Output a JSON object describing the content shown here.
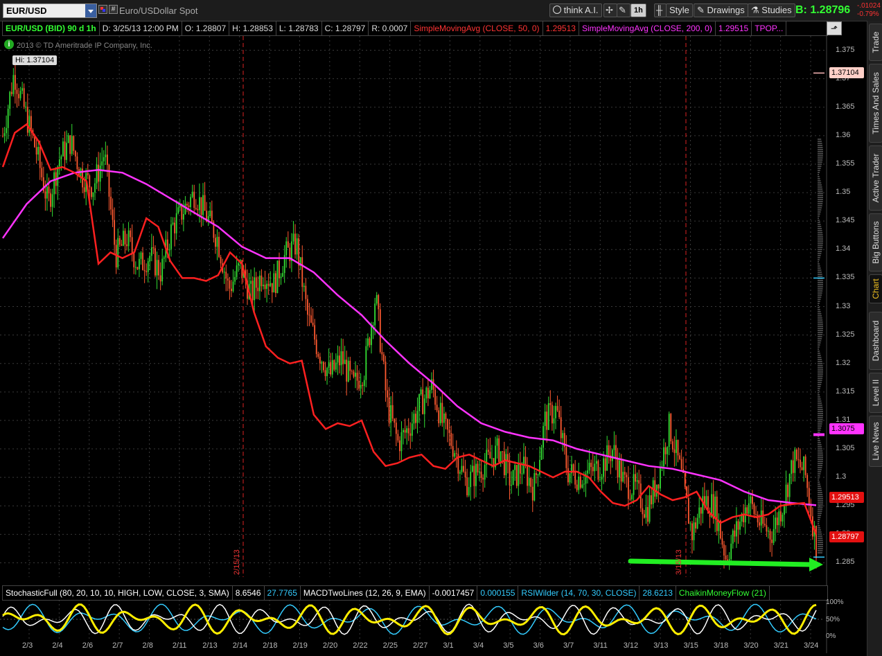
{
  "toolbar": {
    "symbol": "EUR/USD",
    "description": "Euro/USDollar Spot",
    "think_ai": "think A.I.",
    "interval": "1h",
    "style": "Style",
    "drawings": "Drawings",
    "studies": "Studies",
    "bid": "B: 1.28796",
    "change_abs": "-.01024",
    "change_pct": "-0.79%"
  },
  "info": {
    "instrument": "EUR/USD (BID) 90 d 1h",
    "date": "D: 3/25/13 12:00 PM",
    "open": "O: 1.28807",
    "high": "H: 1.28853",
    "low": "L: 1.28783",
    "close": "C: 1.28797",
    "range": "R: 0.0007",
    "sma50_label": "SimpleMovingAvg (CLOSE, 50, 0)",
    "sma50_value": "1.29513",
    "sma200_label": "SimpleMovingAvg (CLOSE, 200, 0)",
    "sma200_value": "1.29515",
    "tpop": "TPOP..."
  },
  "chart": {
    "copyright": "2013 © TD Ameritrade IP Company, Inc.",
    "hi_label": "Hi: 1.37104",
    "date_markers": [
      "2/15/13",
      "3/15/13"
    ]
  },
  "price_tags": {
    "high": "1.37104",
    "sma200": "1.3075",
    "sma50": "1.29513",
    "last": "1.28797"
  },
  "studies": {
    "stoch_label": "StochasticFull (80, 20, 10, 10, HIGH, LOW, CLOSE, 3, SMA)",
    "stoch_v1": "8.6546",
    "stoch_v2": "27.7765",
    "macd_label": "MACDTwoLines (12, 26, 9, EMA)",
    "macd_v1": "-0.0017457",
    "macd_v2": "0.000155",
    "rsi_label": "RSIWilder (14, 70, 30, CLOSE)",
    "rsi_v": "28.6213",
    "cmf_label": "ChaikinMoneyFlow (21)",
    "pct_100": "100%",
    "pct_50": "50%",
    "pct_0": "0%"
  },
  "sidebar": [
    "Trade",
    "Times And Sales",
    "Active Trader",
    "Big Buttons",
    "Chart",
    "Dashboard",
    "Level II",
    "Live News"
  ],
  "colors": {
    "sma50": "#ff2020",
    "sma200": "#ff33ff",
    "up_candle": "#33dd33",
    "down_candle": "#ff5a30",
    "arrow": "#22ee22"
  },
  "chart_data": {
    "type": "line",
    "title": "EUR/USD (BID) 90 d 1h",
    "ylim": [
      1.2825,
      1.3775
    ],
    "y_ticks": [
      "1.375",
      "1.37",
      "1.365",
      "1.36",
      "1.355",
      "1.35",
      "1.345",
      "1.34",
      "1.335",
      "1.33",
      "1.325",
      "1.32",
      "1.315",
      "1.31",
      "1.305",
      "1.3",
      "1.295",
      "1.29",
      "1.285"
    ],
    "x_ticks": [
      "2/3",
      "2/4",
      "2/6",
      "2/7",
      "2/8",
      "2/11",
      "2/13",
      "2/14",
      "2/18",
      "2/19",
      "2/20",
      "2/22",
      "2/25",
      "2/27",
      "3/1",
      "3/4",
      "3/5",
      "3/6",
      "3/7",
      "3/11",
      "3/12",
      "3/13",
      "3/15",
      "3/18",
      "3/20",
      "3/21",
      "3/24"
    ],
    "series": [
      {
        "name": "EUR/USD",
        "values": [
          1.36,
          1.371,
          1.364,
          1.357,
          1.348,
          1.356,
          1.359,
          1.353,
          1.351,
          1.357,
          1.339,
          1.342,
          1.337,
          1.339,
          1.336,
          1.344,
          1.347,
          1.35,
          1.346,
          1.342,
          1.333,
          1.337,
          1.332,
          1.336,
          1.334,
          1.339,
          1.341,
          1.328,
          1.322,
          1.318,
          1.321,
          1.316,
          1.319,
          1.332,
          1.313,
          1.306,
          1.309,
          1.313,
          1.316,
          1.309,
          1.305,
          1.299,
          1.301,
          1.303,
          1.305,
          1.299,
          1.302,
          1.298,
          1.31,
          1.312,
          1.301,
          1.3,
          1.301,
          1.302,
          1.305,
          1.299,
          1.298,
          1.294,
          1.3,
          1.309,
          1.301,
          1.29,
          1.296,
          1.295,
          1.286,
          1.291,
          1.296,
          1.292,
          1.29,
          1.295,
          1.303,
          1.301,
          1.288
        ]
      },
      {
        "name": "SimpleMovingAvg (CLOSE, 50, 0)",
        "values": [
          1.3545,
          1.3605,
          1.362,
          1.359,
          1.354,
          1.3545,
          1.3535,
          1.352,
          1.3375,
          1.3395,
          1.3385,
          1.3395,
          1.3455,
          1.344,
          1.338,
          1.335,
          1.335,
          1.3345,
          1.3355,
          1.3395,
          1.3375,
          1.329,
          1.323,
          1.321,
          1.32,
          1.3205,
          1.311,
          1.3085,
          1.3095,
          1.309,
          1.31,
          1.3045,
          1.302,
          1.3025,
          1.3035,
          1.304,
          1.302,
          1.3015,
          1.3035,
          1.304,
          1.303,
          1.302,
          1.303,
          1.3025,
          1.302,
          1.301,
          1.3,
          1.301,
          1.301,
          1.3,
          1.2975,
          1.2955,
          1.295,
          1.296,
          1.2985,
          1.297,
          1.296,
          1.2965,
          1.2975,
          1.294,
          1.292,
          1.293,
          1.2935,
          1.293,
          1.2935,
          1.295,
          1.2953,
          1.2955,
          1.29
        ]
      },
      {
        "name": "SimpleMovingAvg (CLOSE, 200, 0)",
        "values": [
          1.342,
          1.348,
          1.352,
          1.3535,
          1.354,
          1.3535,
          1.3515,
          1.349,
          1.3465,
          1.344,
          1.3405,
          1.3385,
          1.3385,
          1.336,
          1.332,
          1.3285,
          1.324,
          1.32,
          1.3165,
          1.3125,
          1.3095,
          1.308,
          1.307,
          1.3065,
          1.305,
          1.304,
          1.303,
          1.302,
          1.3015,
          1.3005,
          1.2995,
          1.2975,
          1.296,
          1.2955,
          1.2951
        ]
      }
    ]
  }
}
